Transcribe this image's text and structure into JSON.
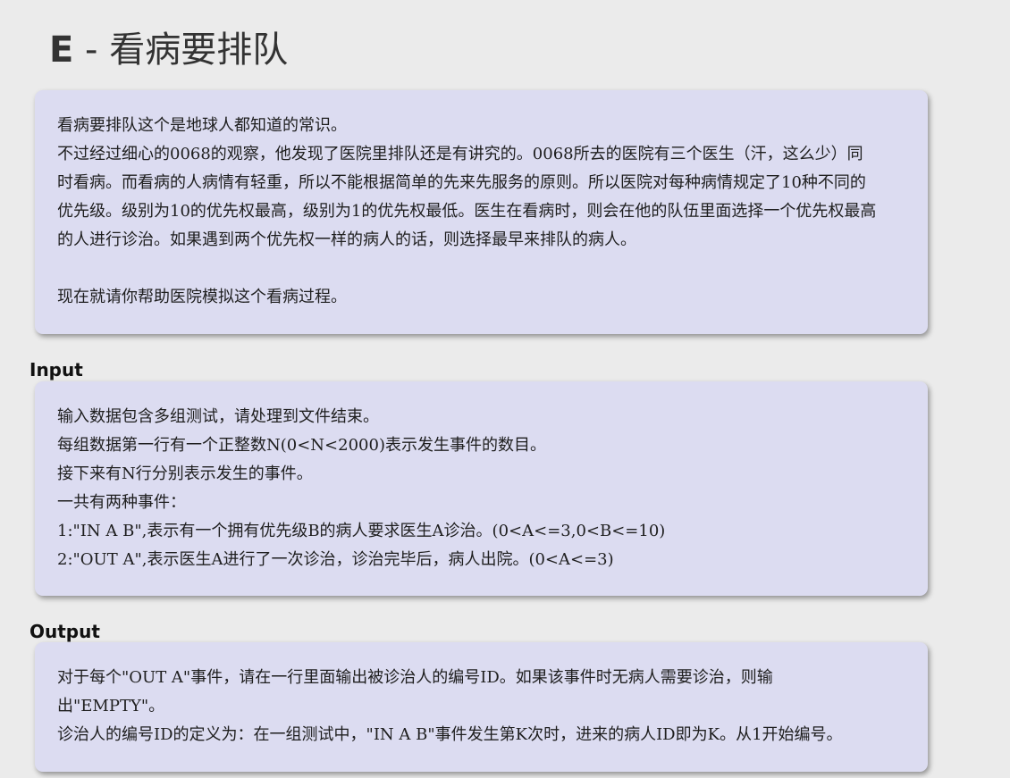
{
  "problem": {
    "title_letter": "E",
    "title_separator": " - ",
    "title_text": "看病要排队"
  },
  "description": {
    "lines": [
      "看病要排队这个是地球人都知道的常识。",
      "不过经过细心的0068的观察，他发现了医院里排队还是有讲究的。0068所去的医院有三个医生（汗，这么少）同",
      "时看病。而看病的人病情有轻重，所以不能根据简单的先来先服务的原则。所以医院对每种病情规定了10种不同的",
      "优先级。级别为10的优先权最高，级别为1的优先权最低。医生在看病时，则会在他的队伍里面选择一个优先权最高",
      "的人进行诊治。如果遇到两个优先权一样的病人的话，则选择最早来排队的病人。",
      "",
      "现在就请你帮助医院模拟这个看病过程。"
    ]
  },
  "input": {
    "heading": "Input",
    "lines": [
      "输入数据包含多组测试，请处理到文件结束。",
      "每组数据第一行有一个正整数N(0<N<2000)表示发生事件的数目。",
      "接下来有N行分别表示发生的事件。",
      "一共有两种事件：",
      "1:\"IN A B\",表示有一个拥有优先级B的病人要求医生A诊治。(0<A<=3,0<B<=10)",
      "2:\"OUT A\",表示医生A进行了一次诊治，诊治完毕后，病人出院。(0<A<=3)"
    ]
  },
  "output": {
    "heading": "Output",
    "lines": [
      "对于每个\"OUT A\"事件，请在一行里面输出被诊治人的编号ID。如果该事件时无病人需要诊治，则输",
      "出\"EMPTY\"。",
      "诊治人的编号ID的定义为：在一组测试中，\"IN A B\"事件发生第K次时，进来的病人ID即为K。从1开始编号。"
    ]
  }
}
